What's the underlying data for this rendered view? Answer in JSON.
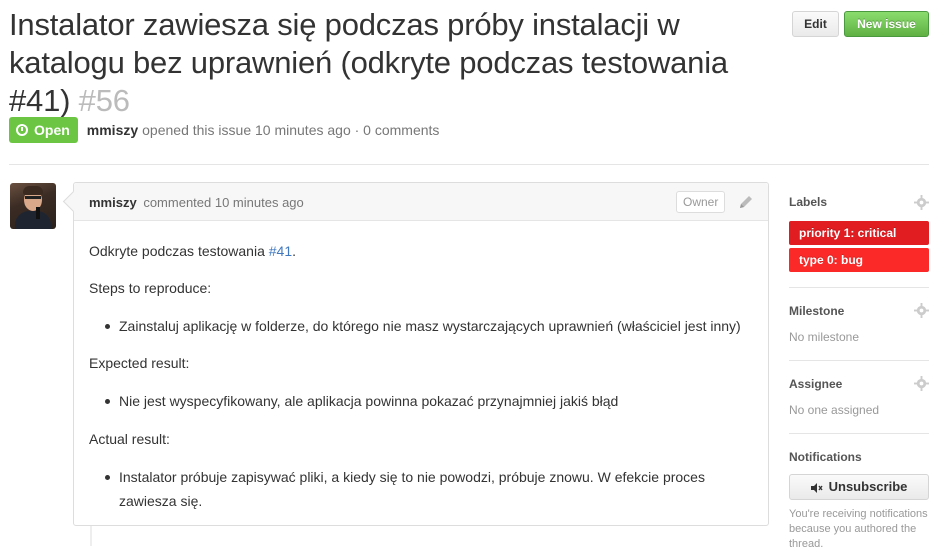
{
  "issue": {
    "title": "Instalator zawiesza się podczas próby instalacji w katalogu bez uprawnień (odkryte podczas testowania #41)",
    "number": "#56",
    "state": "Open",
    "author": "mmiszy",
    "meta_text": "opened this issue 10 minutes ago · 0 comments"
  },
  "header_buttons": {
    "edit": "Edit",
    "new_issue": "New issue"
  },
  "comment": {
    "author": "mmiszy",
    "action": "commented 10 minutes ago",
    "badge": "Owner",
    "line1_text": "Odkryte podczas testowania ",
    "line1_link": "#41",
    "line1_end": ".",
    "steps_heading": "Steps to reproduce:",
    "steps_item": "Zainstaluj aplikację w folderze, do którego nie masz wystarczających uprawnień (właściciel jest inny)",
    "expected_heading": "Expected result:",
    "expected_item": "Nie jest wyspecyfikowany, ale aplikacja powinna pokazać przynajmniej jakiś błąd",
    "actual_heading": "Actual result:",
    "actual_item_line1": "Instalator próbuje zapisywać pliki, a kiedy się to nie powodzi, próbuje znowu. W efekcie proces",
    "actual_item_line2": "zawiesza się."
  },
  "sidebar": {
    "labels_title": "Labels",
    "labels": [
      {
        "name": "priority 1: critical",
        "color": "#e11d21"
      },
      {
        "name": "type 0: bug",
        "color": "#fc2929"
      }
    ],
    "milestone_title": "Milestone",
    "milestone_value": "No milestone",
    "assignee_title": "Assignee",
    "assignee_value": "No one assigned",
    "notifications_title": "Notifications",
    "unsubscribe_label": "Unsubscribe",
    "notifications_note": "You're receiving notifications because you authored the thread."
  },
  "icons": [
    "issue-opened-icon",
    "pencil-icon",
    "gear-icon",
    "mute-icon"
  ],
  "colors": {
    "open_green": "#6cc644",
    "link_blue": "#4078c0",
    "new_issue_green": "#60b044"
  }
}
